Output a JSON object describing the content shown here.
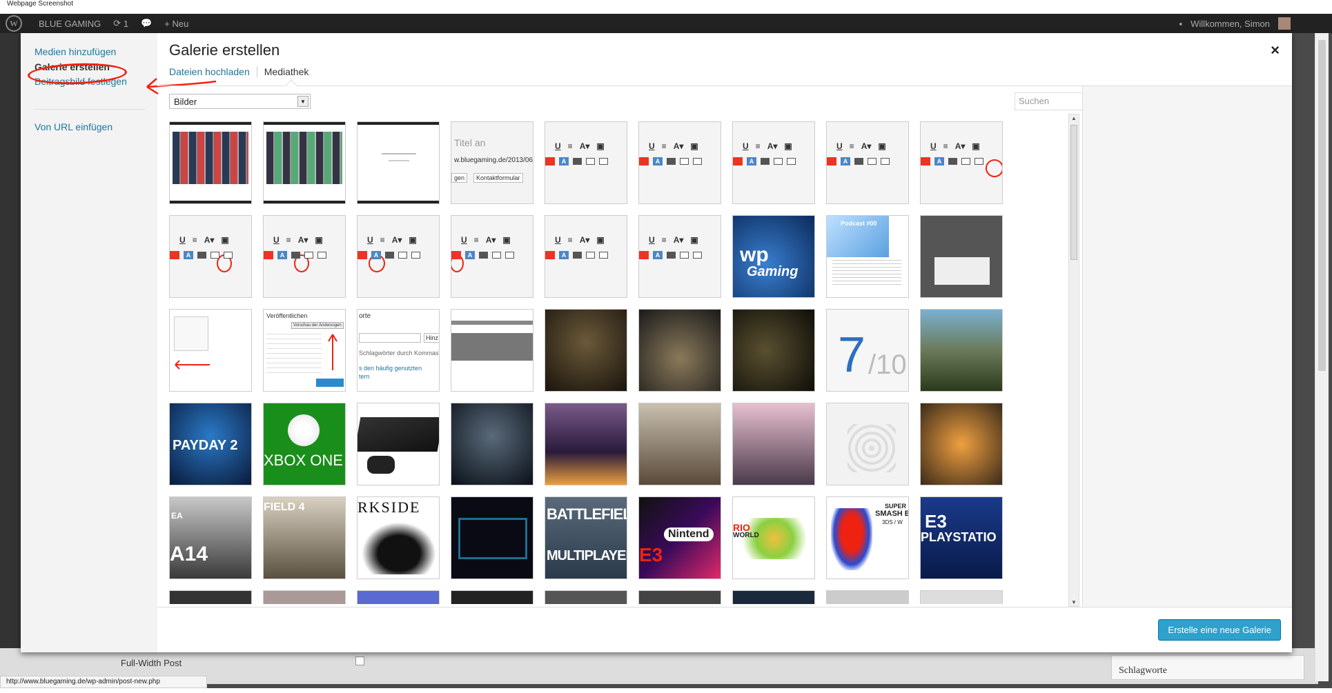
{
  "screenshot_label": "Webpage Screenshot",
  "adminbar": {
    "site_name": "BLUE GAMING",
    "updates_count": "1",
    "new_label": "Neu",
    "welcome": "Willkommen, Simon"
  },
  "modal": {
    "menu": {
      "items": [
        {
          "label": "Medien hinzufügen",
          "active": false
        },
        {
          "label": "Galerie erstellen",
          "active": true
        },
        {
          "label": "Beitragsbild festlegen",
          "active": false
        },
        {
          "label": "Von URL einfügen",
          "active": false
        }
      ]
    },
    "title": "Galerie erstellen",
    "close_label": "×",
    "tabs": [
      {
        "label": "Dateien hochladen",
        "active": false
      },
      {
        "label": "Mediathek",
        "active": true
      }
    ],
    "filter": {
      "value": "Bilder"
    },
    "search": {
      "placeholder": "Suchen"
    },
    "create_button": "Erstelle eine neue Galerie"
  },
  "thumb_text": {
    "titel_an": "Titel an",
    "url": "w.bluegaming.de/2013/06/",
    "kontakt": "Kontaktformular",
    "gen": "gen",
    "veroffentlichen": "Veröffentlichen",
    "vorschau": "Vorschau der Änderungen",
    "orte": "orte",
    "hinz": "Hinz",
    "schlag": "Schlagwörter durch Kommas",
    "haeufig": "s den häufig genutzten",
    "ern": "tern",
    "seven": "7",
    "ten": "/10",
    "payday": "PAYDAY 2",
    "xbox": "XBOX ONE",
    "rkside": "RKSIDE",
    "battlefield": "BATTLEFIELD",
    "multiplayer": "MULTIPLAYER",
    "nintendo": "Nintend",
    "e3": "E3",
    "e3ps": "E3",
    "playstation": "PLAYSTATIO",
    "fifa": "A14",
    "ea": "EA",
    "bf4": "FIELD 4",
    "podcast": "Podcast #00",
    "wp": "wp",
    "gaming": "Gaming",
    "super": "SUPER",
    "smash": "SMASH B",
    "ds": "3DS / W",
    "world": "WORLD",
    "rio": "RIO"
  },
  "bottom": {
    "full_width": "Full-Width Post",
    "schlagworte": "Schlagworte"
  },
  "statusbar": "http://www.bluegaming.de/wp-admin/post-new.php"
}
